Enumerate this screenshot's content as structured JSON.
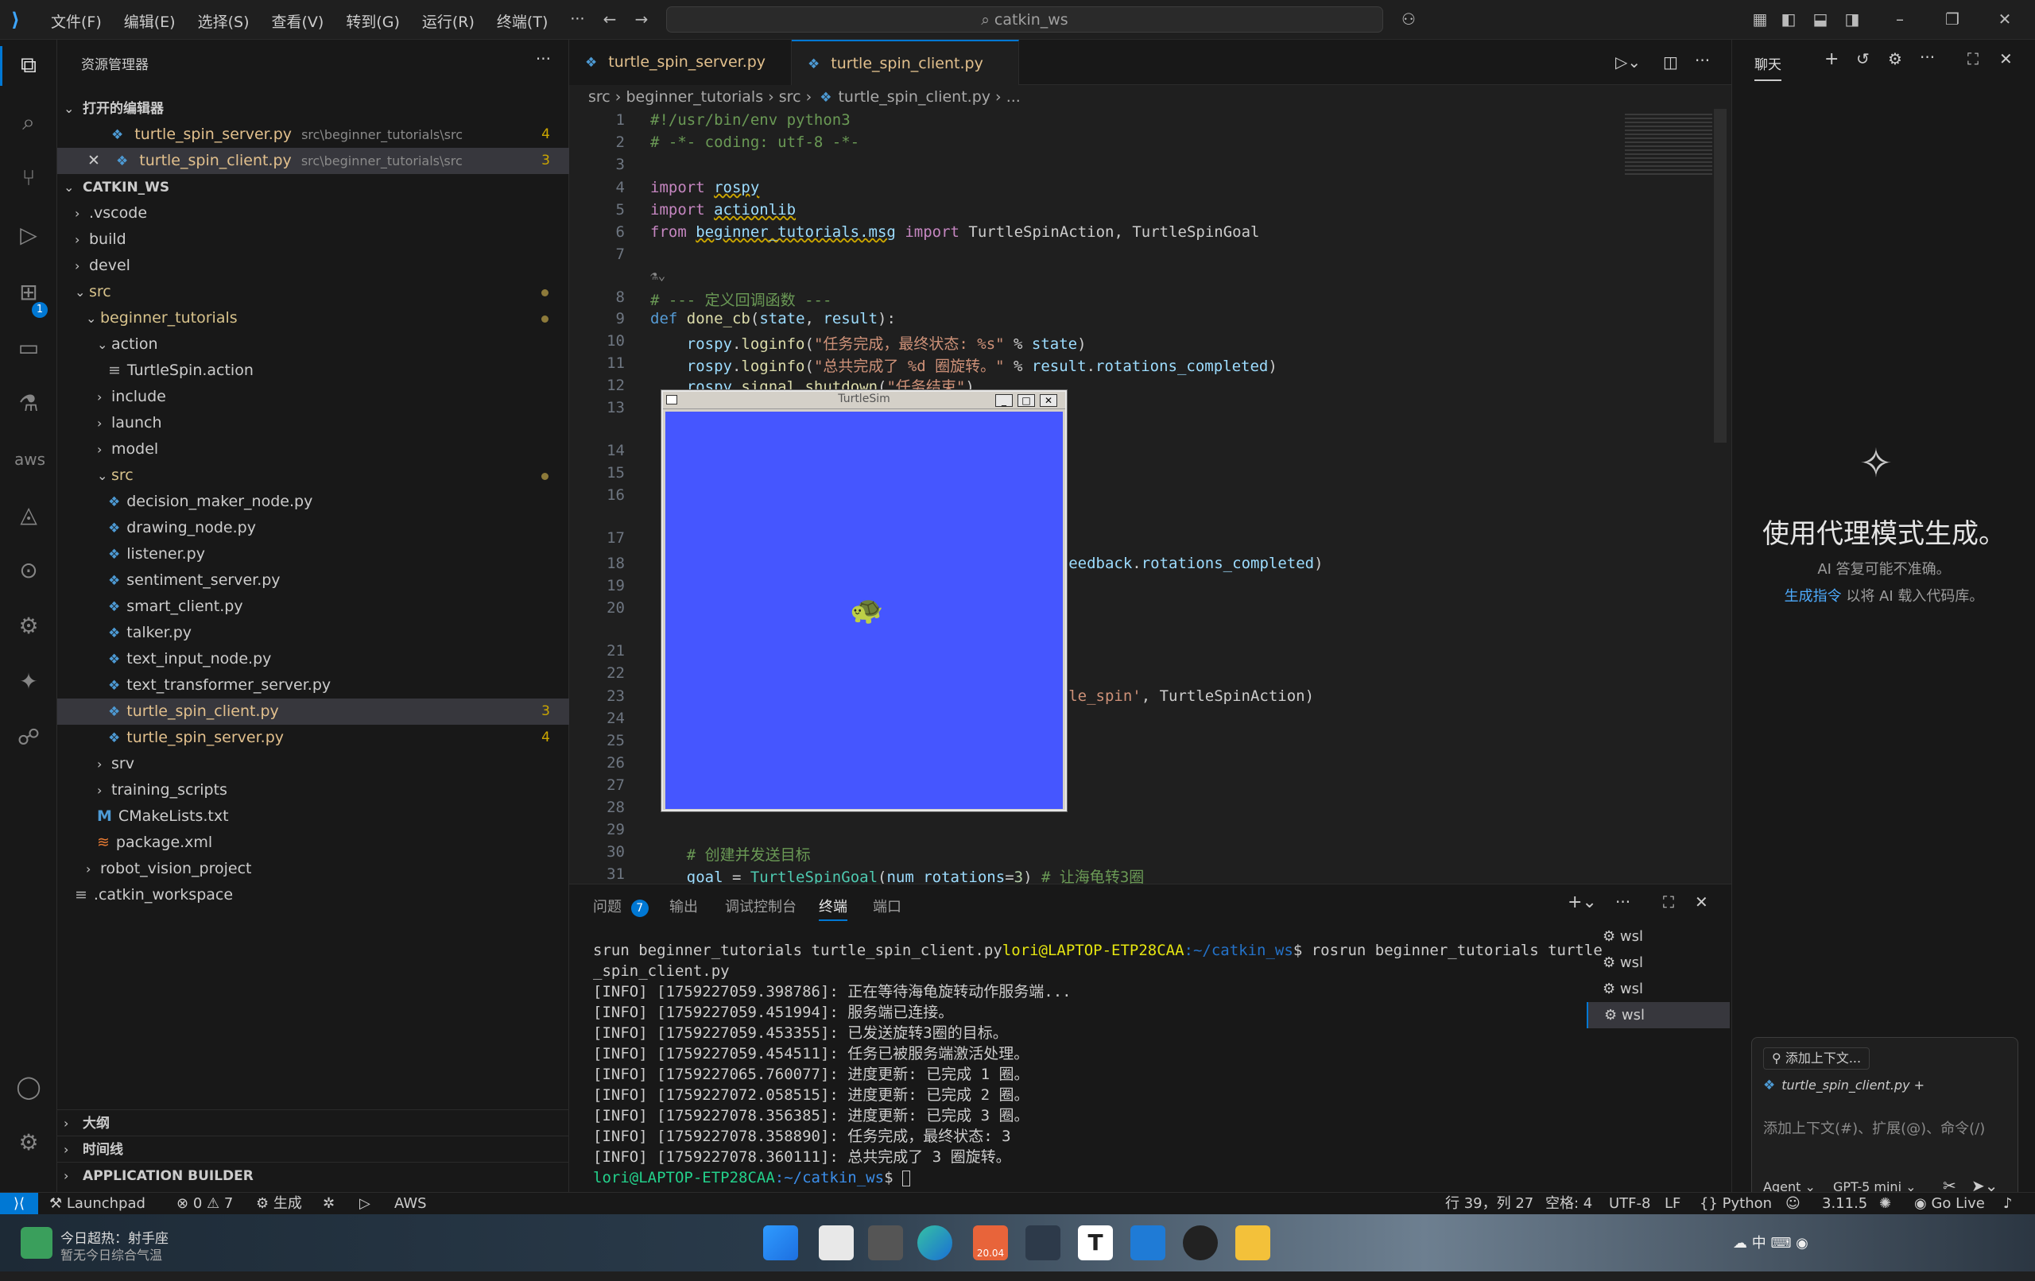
{
  "titlebar": {
    "menus": [
      "文件(F)",
      "编辑(E)",
      "选择(S)",
      "查看(V)",
      "转到(G)",
      "运行(R)",
      "终端(T)",
      "···"
    ],
    "search": "catkin_ws"
  },
  "explorer": {
    "header": "资源管理器",
    "open_editors_title": "打开的编辑器",
    "open_editors": [
      {
        "name": "turtle_spin_server.py",
        "path": "src\\beginner_tutorials\\src",
        "badge": "4"
      },
      {
        "name": "turtle_spin_client.py",
        "path": "src\\beginner_tutorials\\src",
        "badge": "3"
      }
    ],
    "workspace_title": "CATKIN_WS",
    "tree": [
      {
        "label": ".vscode"
      },
      {
        "label": "build"
      },
      {
        "label": "devel"
      },
      {
        "label": "src"
      },
      {
        "label": "beginner_tutorials"
      },
      {
        "label": "action"
      },
      {
        "label": "TurtleSpin.action"
      },
      {
        "label": "include"
      },
      {
        "label": "launch"
      },
      {
        "label": "model"
      },
      {
        "label": "src"
      },
      {
        "label": "decision_maker_node.py"
      },
      {
        "label": "drawing_node.py"
      },
      {
        "label": "listener.py"
      },
      {
        "label": "sentiment_server.py"
      },
      {
        "label": "smart_client.py"
      },
      {
        "label": "talker.py"
      },
      {
        "label": "text_input_node.py"
      },
      {
        "label": "text_transformer_server.py"
      },
      {
        "label": "turtle_spin_client.py",
        "badge": "3"
      },
      {
        "label": "turtle_spin_server.py",
        "badge": "4"
      },
      {
        "label": "srv"
      },
      {
        "label": "training_scripts"
      },
      {
        "label": "CMakeLists.txt"
      },
      {
        "label": "package.xml"
      },
      {
        "label": "robot_vision_project"
      },
      {
        "label": ".catkin_workspace"
      }
    ],
    "outline": "大纲",
    "timeline": "时间线",
    "app_builder": "APPLICATION BUILDER"
  },
  "tabs": [
    {
      "label": "turtle_spin_server.py",
      "badge": "4"
    },
    {
      "label": "turtle_spin_client.py",
      "badge": "3"
    }
  ],
  "breadcrumb": [
    "src",
    "beginner_tutorials",
    "src",
    "turtle_spin_client.py",
    "..."
  ],
  "code": {
    "line_numbers": [
      "1",
      "2",
      "3",
      "4",
      "5",
      "6",
      "7",
      "8",
      "9",
      "10",
      "11",
      "12",
      "13",
      "14",
      "15",
      "16",
      "17",
      "18",
      "19",
      "20",
      "21",
      "22",
      "23",
      "24",
      "25",
      "26",
      "27",
      "28",
      "29",
      "30",
      "31"
    ],
    "l1": "#!/usr/bin/env python3",
    "l2": "# -*- coding: utf-8 -*-",
    "l8": "# --- 定义回调函数 ---",
    "l10_str": "\"任务完成，最终状态: %s\"",
    "l11_str": "\"总共完成了 %d 圈旋转。\"",
    "l30": "# 创建并发送目标",
    "l31_cm": "# 让海龟转3圈"
  },
  "turtlesim": {
    "title": "TurtleSim",
    "bg": "#4556ff"
  },
  "panel": {
    "tabs": [
      "问题",
      "输出",
      "调试控制台",
      "终端",
      "端口"
    ],
    "problems_count": "7",
    "terminals": [
      "wsl",
      "wsl",
      "wsl",
      "wsl"
    ],
    "lines": [
      "srun beginner_tutorials turtle_spin_client.py",
      "_spin_client.py",
      "[INFO] [1759227059.398786]: 正在等待海龟旋转动作服务端...",
      "[INFO] [1759227059.451994]: 服务端已连接。",
      "[INFO] [1759227059.453355]: 已发送旋转3圈的目标。",
      "[INFO] [1759227059.454511]: 任务已被服务端激活处理。",
      "[INFO] [1759227065.760077]: 进度更新: 已完成 1 圈。",
      "[INFO] [1759227072.058515]: 进度更新: 已完成 2 圈。",
      "[INFO] [1759227078.356385]: 进度更新: 已完成 3 圈。",
      "[INFO] [1759227078.358890]: 任务完成，最终状态: 3",
      "[INFO] [1759227078.360111]: 总共完成了 3 圈旋转。"
    ],
    "prompt_user": "lori@LAPTOP-ETP28CAA",
    "prompt_path": ":~/catkin_ws",
    "prompt_cmd": "$ rosrun beginner_tutorials turtle"
  },
  "chat": {
    "title": "聊天",
    "headline": "使用代理模式生成。",
    "sub": "AI 答复可能不准确。",
    "link": "生成指令",
    "link_after": "以将 AI 载入代码库。",
    "add_context": "添加上下文...",
    "context_file": "turtle_spin_client.py",
    "input_placeholder": "添加上下文(#)、扩展(@)、命令(/)",
    "mode": "Agent",
    "model": "GPT-5 mini"
  },
  "status": {
    "launchpad": "Launchpad",
    "errors": "0",
    "warnings": "7",
    "gen": "生成",
    "aws": "AWS",
    "pos": "行 39，列 27",
    "spaces": "空格: 4",
    "enc": "UTF-8",
    "eol": "LF",
    "lang": "Python",
    "pyver": "3.11.5",
    "golive": "Go Live"
  },
  "taskbar": {
    "weather1": "今日超热：射手座",
    "weather2": "暂无今日综合气温",
    "cal": "20.04"
  },
  "colors": {
    "accent": "#0078d4",
    "bg": "#1f1f1f",
    "side": "#181818"
  }
}
